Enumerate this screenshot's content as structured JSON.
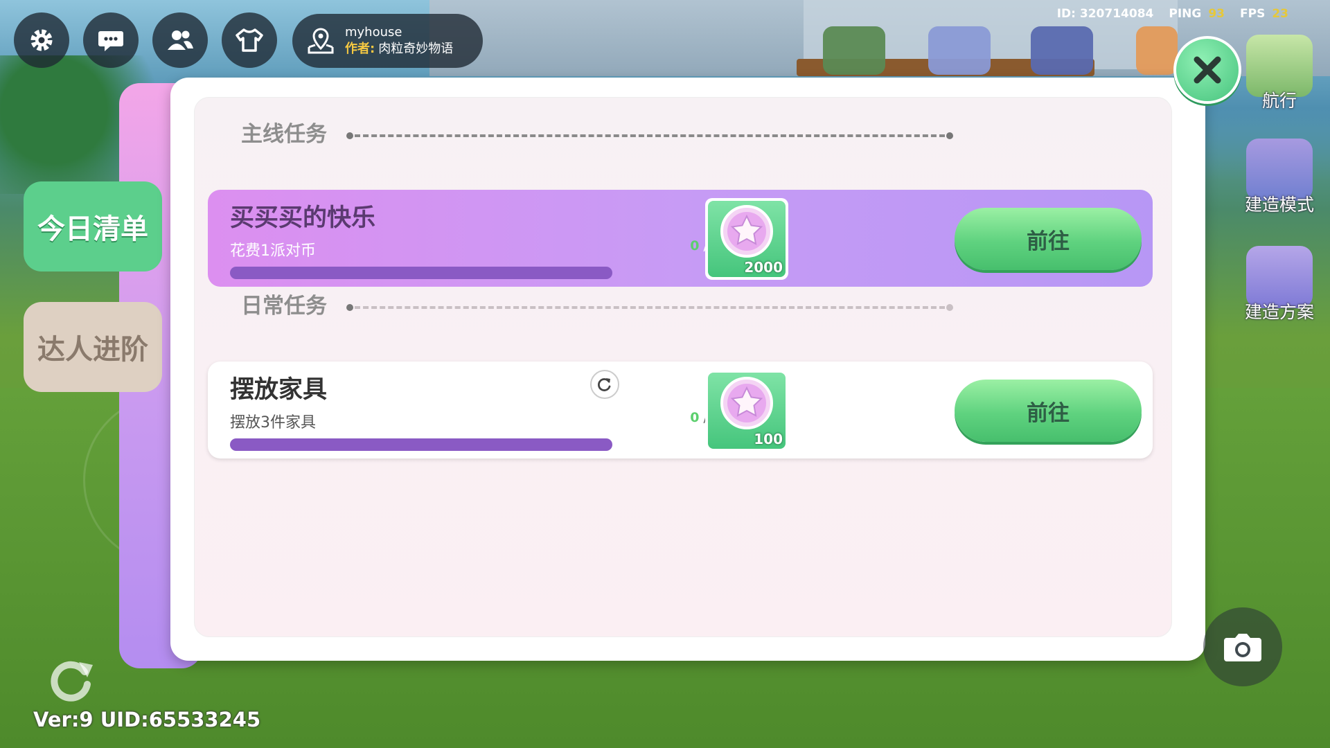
{
  "top_bar": {
    "buttons": [
      {
        "name": "settings",
        "icon": "gear-icon"
      },
      {
        "name": "chat",
        "icon": "chat-bubble-icon"
      },
      {
        "name": "friends",
        "icon": "people-icon"
      },
      {
        "name": "outfit",
        "icon": "shirt-icon"
      }
    ],
    "location": {
      "icon": "map-pin-icon",
      "name": "myhouse",
      "author_label": "作者:",
      "author": "肉粒奇妙物语"
    },
    "stats": {
      "id_label": "ID:",
      "id": "320714084",
      "ping_label": "PING",
      "ping": "93",
      "fps_label": "FPS",
      "fps": "23"
    }
  },
  "right_sidebar": [
    {
      "label": "航行",
      "icon": "boat-icon"
    },
    {
      "label": "建造模式",
      "icon": "hammer-icon"
    },
    {
      "label": "建造方案",
      "icon": "house-plan-icon"
    }
  ],
  "tabs": [
    {
      "label": "今日清单",
      "active": true
    },
    {
      "label": "达人进阶",
      "active": false
    }
  ],
  "panel": {
    "main_section_title": "主线任务",
    "daily_section_title": "日常任务",
    "main_task": {
      "title": "买买买的快乐",
      "description": "花费1派对币",
      "progress_current": "0",
      "progress_total": "/ 1",
      "progress_fraction": 0,
      "reward_amount": "2000",
      "reward_icon": "star-coin-icon",
      "button_label": "前往"
    },
    "daily_task": {
      "title": "摆放家具",
      "description": "摆放3件家具",
      "progress_current": "0",
      "progress_total": "/ 3",
      "progress_fraction": 0,
      "reward_amount": "100",
      "reward_icon": "star-coin-icon",
      "refresh_icon": "refresh-icon",
      "button_label": "前往"
    }
  },
  "footer": {
    "version_text": "Ver:9 UID:65533245",
    "reload_icon": "reload-icon"
  },
  "colors": {
    "accent_green": "#5ccf8c",
    "main_task_purple": "#c79bf5",
    "progress_track": "#8a5ac4",
    "progress_current": "#5ccf6e",
    "stat_value": "#e6c83a"
  }
}
